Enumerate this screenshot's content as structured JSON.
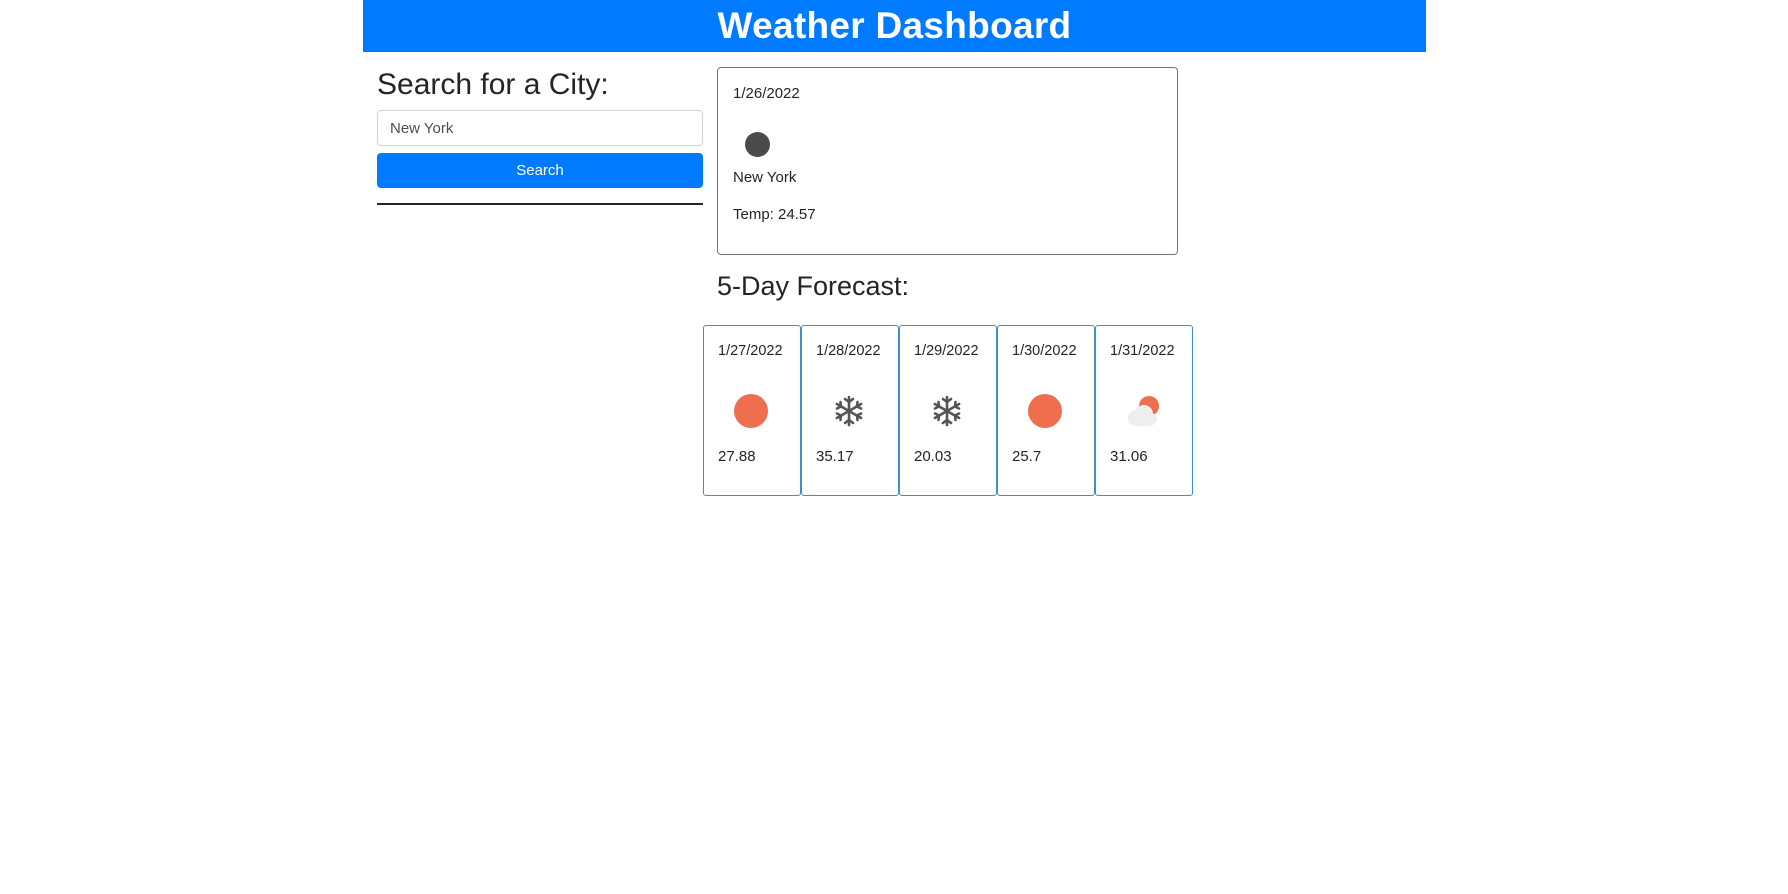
{
  "header": {
    "title": "Weather Dashboard"
  },
  "search": {
    "heading": "Search for a City:",
    "input_value": "New York",
    "button_label": "Search"
  },
  "current": {
    "date": "1/26/2022",
    "icon": "dark-circle-icon",
    "city": "New York",
    "temp_text": "Temp: 24.57"
  },
  "forecast": {
    "heading": "5-Day Forecast:",
    "days": [
      {
        "date": "1/27/2022",
        "icon": "sun-icon",
        "temp": "27.88"
      },
      {
        "date": "1/28/2022",
        "icon": "snowflake-icon",
        "temp": "35.17"
      },
      {
        "date": "1/29/2022",
        "icon": "snowflake-icon",
        "temp": "20.03"
      },
      {
        "date": "1/30/2022",
        "icon": "sun-icon",
        "temp": "25.7"
      },
      {
        "date": "1/31/2022",
        "icon": "partly-cloudy-icon",
        "temp": "31.06"
      }
    ]
  },
  "colors": {
    "primary": "#007bff",
    "sun": "#ee6e4f",
    "snow": "#555555",
    "card_border": "#3e8ed0"
  }
}
